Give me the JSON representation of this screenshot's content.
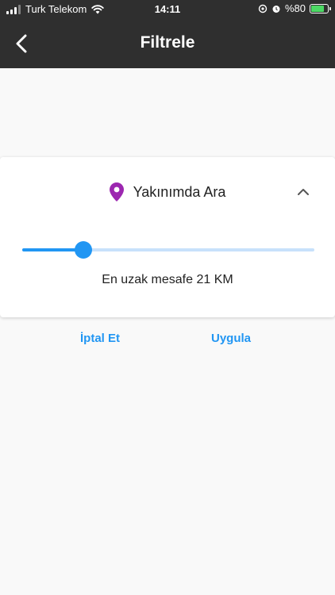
{
  "status_bar": {
    "carrier": "Turk Telekom",
    "time": "14:11",
    "battery": "%80",
    "battery_level": 0.8,
    "icons": [
      "signal-icon",
      "wifi-icon",
      "location-lock-icon",
      "alarm-icon",
      "battery-charging-icon"
    ]
  },
  "app_bar": {
    "title": "Filtrele",
    "back_icon": "chevron-left-icon",
    "background": "#2f2f2f"
  },
  "filter_card": {
    "title": "Yakınımda Ara",
    "icon": "location-pin-icon",
    "icon_color": "#9c27b0",
    "collapse_icon": "chevron-up-icon",
    "slider_value_fraction": 0.21,
    "slider_color": "#2196f3",
    "distance_label": "En uzak mesafe 21 KM"
  },
  "actions": {
    "cancel": "İptal Et",
    "apply": "Uygula",
    "color": "#2196f3"
  }
}
